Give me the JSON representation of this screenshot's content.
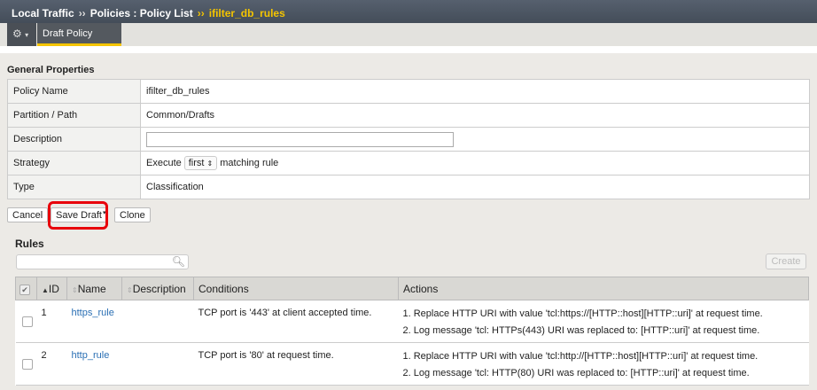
{
  "breadcrumb": {
    "items": [
      "Local Traffic",
      "Policies : Policy List"
    ],
    "current": "ifilter_db_rules",
    "separator": "››"
  },
  "tabs": {
    "gear_icon": "gear-icon",
    "active": "Draft Policy"
  },
  "general": {
    "title": "General Properties",
    "policy_name_label": "Policy Name",
    "policy_name": "ifilter_db_rules",
    "partition_label": "Partition / Path",
    "partition": "Common/Drafts",
    "description_label": "Description",
    "description": "",
    "strategy_label": "Strategy",
    "strategy_prefix": "Execute",
    "strategy_value": "first",
    "strategy_suffix": "matching rule",
    "type_label": "Type",
    "type": "Classification"
  },
  "buttons": {
    "cancel": "Cancel",
    "save_draft": "Save Draft",
    "clone": "Clone",
    "create": "Create"
  },
  "rules": {
    "title": "Rules",
    "search_placeholder": "",
    "headers": [
      "ID",
      "Name",
      "Description",
      "Conditions",
      "Actions"
    ],
    "rows": [
      {
        "id": "1",
        "name": "https_rule",
        "description": "",
        "conditions": "TCP port is '443' at client accepted time.",
        "actions": [
          "1. Replace HTTP URI with value 'tcl:https://[HTTP::host][HTTP::uri]' at request time.",
          "2. Log message 'tcl: HTTPs(443) URI was replaced to: [HTTP::uri]' at request time."
        ]
      },
      {
        "id": "2",
        "name": "http_rule",
        "description": "",
        "conditions": "TCP port is '80' at request time.",
        "actions": [
          "1. Replace HTTP URI with value 'tcl:http://[HTTP::host][HTTP::uri]' at request time.",
          "2. Log message 'tcl: HTTP(80) URI was replaced to: [HTTP::uri]' at request time."
        ]
      }
    ]
  },
  "colors": {
    "accent": "#f4c400",
    "highlight": "#e8000b",
    "link": "#2a6fb4"
  }
}
